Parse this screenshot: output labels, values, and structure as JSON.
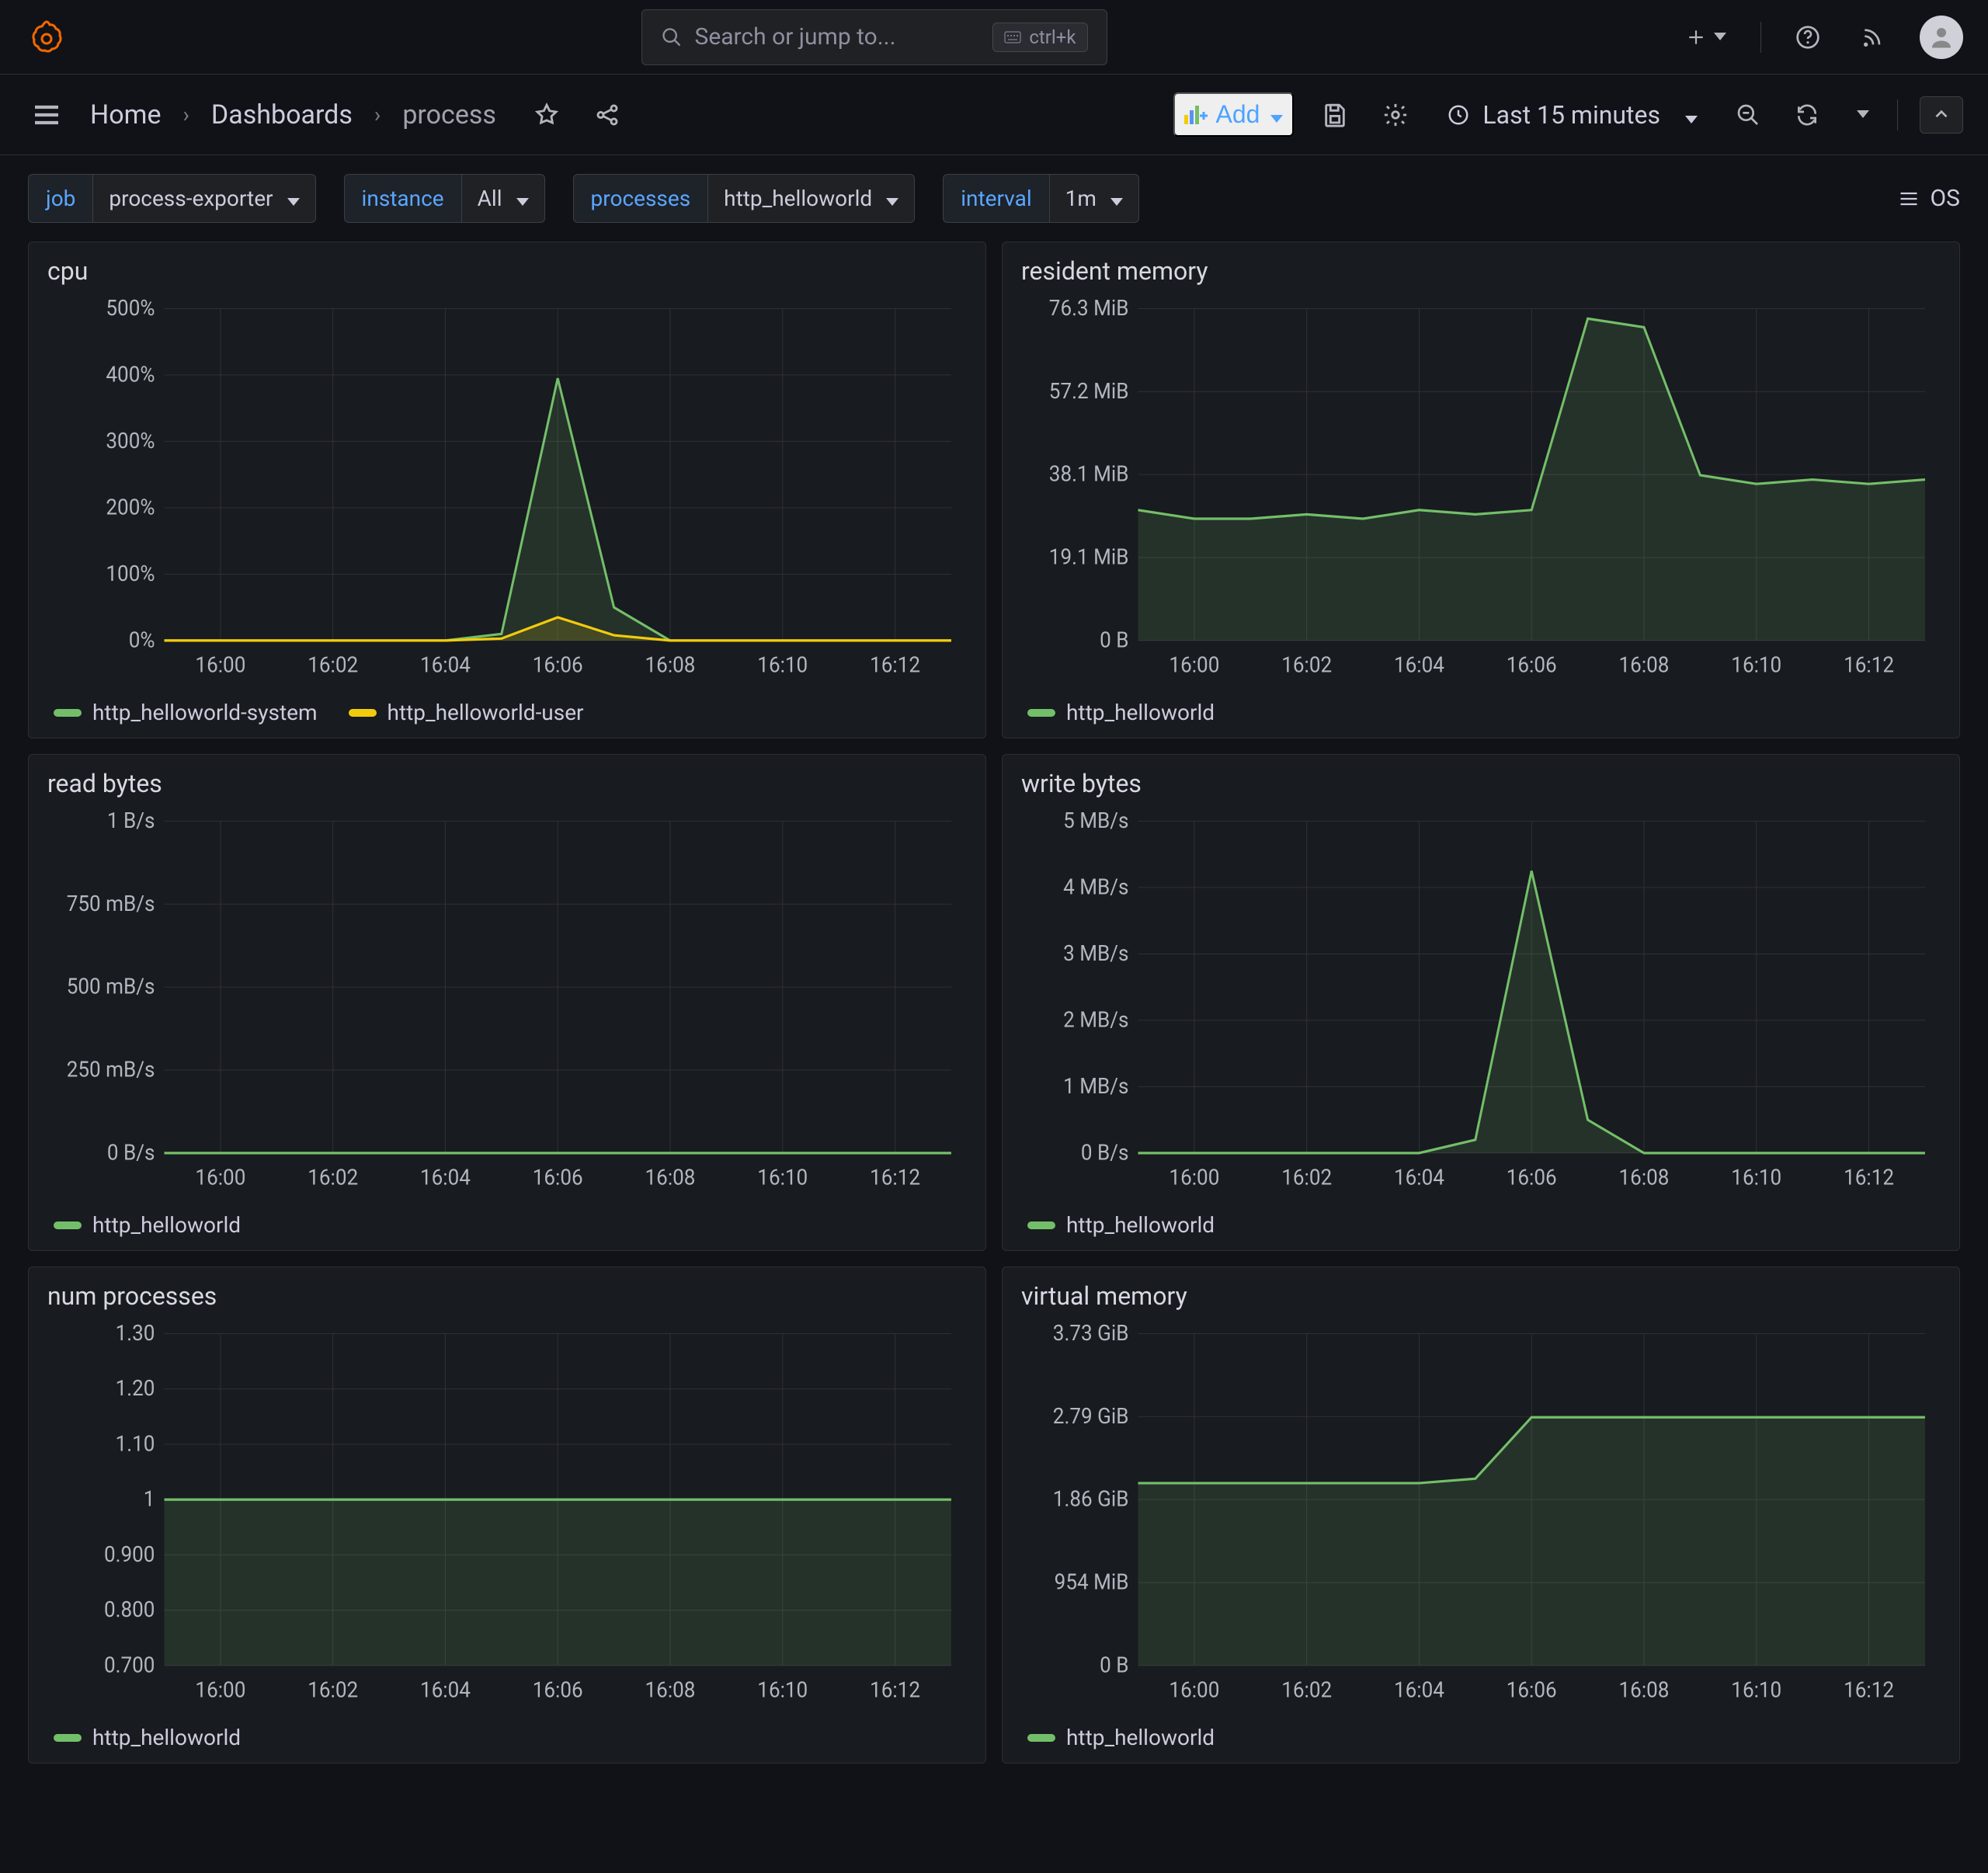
{
  "topbar": {
    "search_placeholder": "Search or jump to...",
    "kbd": "ctrl+k"
  },
  "breadcrumb": {
    "home": "Home",
    "dashboards": "Dashboards",
    "current": "process"
  },
  "toolbar": {
    "add_label": "Add",
    "time_label": "Last 15 minutes"
  },
  "vars": {
    "job_label": "job",
    "job_value": "process-exporter",
    "instance_label": "instance",
    "instance_value": "All",
    "processes_label": "processes",
    "processes_value": "http_helloworld",
    "interval_label": "interval",
    "interval_value": "1m",
    "os_label": "OS"
  },
  "colors": {
    "green": "#73BF69",
    "yellow": "#F2CC0C"
  },
  "chart_data": [
    {
      "id": "cpu",
      "title": "cpu",
      "type": "line",
      "x_ticks": [
        "16:00",
        "16:02",
        "16:04",
        "16:06",
        "16:08",
        "16:10",
        "16:12"
      ],
      "y_ticks": [
        "0%",
        "100%",
        "200%",
        "300%",
        "400%",
        "500%"
      ],
      "ylim": [
        0,
        500
      ],
      "xlim": [
        0,
        14
      ],
      "series": [
        {
          "name": "http_helloworld-system",
          "color": "green",
          "x": [
            0,
            1,
            2,
            3,
            4,
            5,
            6,
            7,
            8,
            9,
            10,
            11,
            12,
            13,
            14
          ],
          "y": [
            0,
            0,
            0,
            0,
            0,
            0,
            10,
            395,
            50,
            0,
            0,
            0,
            0,
            0,
            0
          ]
        },
        {
          "name": "http_helloworld-user",
          "color": "yellow",
          "x": [
            0,
            1,
            2,
            3,
            4,
            5,
            6,
            7,
            8,
            9,
            10,
            11,
            12,
            13,
            14
          ],
          "y": [
            0,
            0,
            0,
            0,
            0,
            0,
            3,
            35,
            8,
            0,
            0,
            0,
            0,
            0,
            0
          ]
        }
      ],
      "fill": true
    },
    {
      "id": "resident_memory",
      "title": "resident memory",
      "type": "line",
      "x_ticks": [
        "16:00",
        "16:02",
        "16:04",
        "16:06",
        "16:08",
        "16:10",
        "16:12"
      ],
      "y_ticks": [
        "0 B",
        "19.1 MiB",
        "38.1 MiB",
        "57.2 MiB",
        "76.3 MiB"
      ],
      "ylim": [
        0,
        76.3
      ],
      "xlim": [
        0,
        14
      ],
      "series": [
        {
          "name": "http_helloworld",
          "color": "green",
          "x": [
            0,
            1,
            2,
            3,
            4,
            5,
            6,
            7,
            8,
            9,
            10,
            11,
            12,
            13,
            14
          ],
          "y": [
            30,
            28,
            28,
            29,
            28,
            30,
            29,
            30,
            74,
            72,
            38,
            36,
            37,
            36,
            37
          ]
        }
      ],
      "fill": true
    },
    {
      "id": "read_bytes",
      "title": "read bytes",
      "type": "line",
      "x_ticks": [
        "16:00",
        "16:02",
        "16:04",
        "16:06",
        "16:08",
        "16:10",
        "16:12"
      ],
      "y_ticks": [
        "0 B/s",
        "250 mB/s",
        "500 mB/s",
        "750 mB/s",
        "1 B/s"
      ],
      "ylim": [
        0,
        1
      ],
      "xlim": [
        0,
        14
      ],
      "series": [
        {
          "name": "http_helloworld",
          "color": "green",
          "x": [
            0,
            1,
            2,
            3,
            4,
            5,
            6,
            7,
            8,
            9,
            10,
            11,
            12,
            13,
            14
          ],
          "y": [
            0,
            0,
            0,
            0,
            0,
            0,
            0,
            0,
            0,
            0,
            0,
            0,
            0,
            0,
            0
          ]
        }
      ],
      "fill": true
    },
    {
      "id": "write_bytes",
      "title": "write bytes",
      "type": "line",
      "x_ticks": [
        "16:00",
        "16:02",
        "16:04",
        "16:06",
        "16:08",
        "16:10",
        "16:12"
      ],
      "y_ticks": [
        "0 B/s",
        "1 MB/s",
        "2 MB/s",
        "3 MB/s",
        "4 MB/s",
        "5 MB/s"
      ],
      "ylim": [
        0,
        5
      ],
      "xlim": [
        0,
        14
      ],
      "series": [
        {
          "name": "http_helloworld",
          "color": "green",
          "x": [
            0,
            1,
            2,
            3,
            4,
            5,
            6,
            7,
            8,
            9,
            10,
            11,
            12,
            13,
            14
          ],
          "y": [
            0,
            0,
            0,
            0,
            0,
            0,
            0.2,
            4.25,
            0.5,
            0,
            0,
            0,
            0,
            0,
            0
          ]
        }
      ],
      "fill": true
    },
    {
      "id": "num_processes",
      "title": "num processes",
      "type": "line",
      "x_ticks": [
        "16:00",
        "16:02",
        "16:04",
        "16:06",
        "16:08",
        "16:10",
        "16:12"
      ],
      "y_ticks": [
        "0.700",
        "0.800",
        "0.900",
        "1",
        "1.10",
        "1.20",
        "1.30"
      ],
      "ylim": [
        0.7,
        1.3
      ],
      "xlim": [
        0,
        14
      ],
      "series": [
        {
          "name": "http_helloworld",
          "color": "green",
          "x": [
            0,
            1,
            2,
            3,
            4,
            5,
            6,
            7,
            8,
            9,
            10,
            11,
            12,
            13,
            14
          ],
          "y": [
            1,
            1,
            1,
            1,
            1,
            1,
            1,
            1,
            1,
            1,
            1,
            1,
            1,
            1,
            1
          ]
        }
      ],
      "fill": true
    },
    {
      "id": "virtual_memory",
      "title": "virtual memory",
      "type": "line",
      "x_ticks": [
        "16:00",
        "16:02",
        "16:04",
        "16:06",
        "16:08",
        "16:10",
        "16:12"
      ],
      "y_ticks": [
        "0 B",
        "954 MiB",
        "1.86 GiB",
        "2.79 GiB",
        "3.73 GiB"
      ],
      "ylim": [
        0,
        3.73
      ],
      "xlim": [
        0,
        14
      ],
      "series": [
        {
          "name": "http_helloworld",
          "color": "green",
          "x": [
            0,
            1,
            2,
            3,
            4,
            5,
            6,
            7,
            8,
            9,
            10,
            11,
            12,
            13,
            14
          ],
          "y": [
            2.05,
            2.05,
            2.05,
            2.05,
            2.05,
            2.05,
            2.1,
            2.79,
            2.79,
            2.79,
            2.79,
            2.79,
            2.79,
            2.79,
            2.79
          ]
        }
      ],
      "fill": true
    }
  ]
}
